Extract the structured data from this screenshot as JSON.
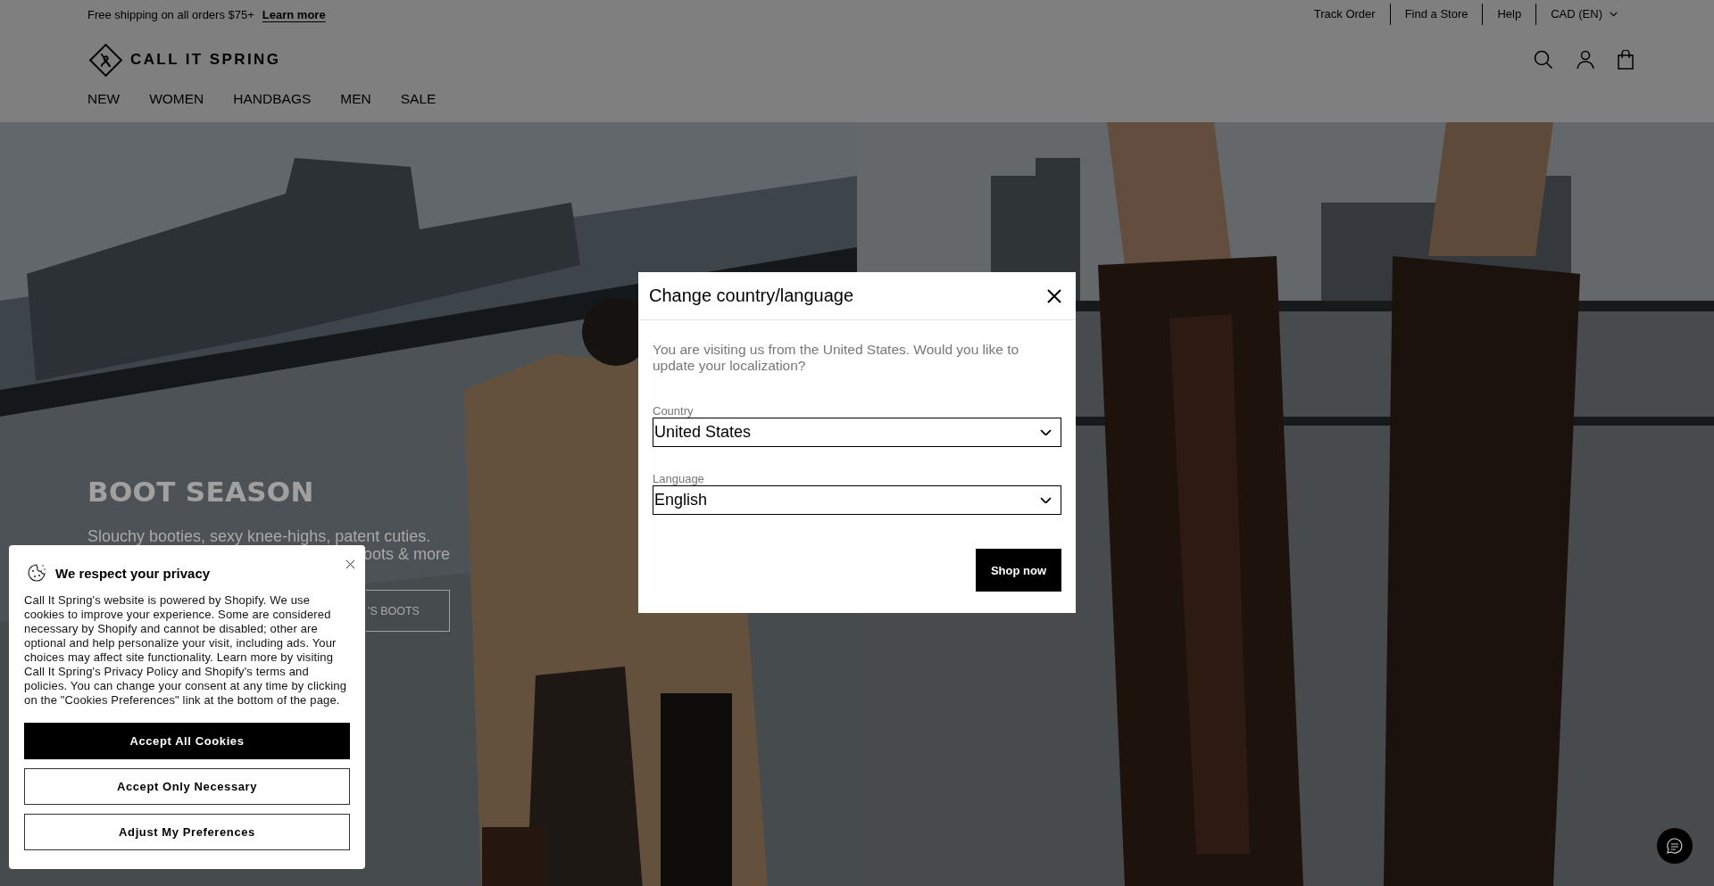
{
  "announcement": {
    "text": "Free shipping on all orders $75+",
    "link": "Learn more"
  },
  "utility_links": [
    {
      "label": "Track Order",
      "kind": "link"
    },
    {
      "label": "Find a Store",
      "kind": "link"
    },
    {
      "label": "Help",
      "kind": "link"
    },
    {
      "label": "CAD (EN)",
      "kind": "dropdown"
    }
  ],
  "logo": {
    "text": "CALL IT SPRING"
  },
  "nav": [
    "NEW",
    "WOMEN",
    "HANDBAGS",
    "MEN",
    "SALE"
  ],
  "hero": {
    "title": "BOOT SEASON",
    "subtitle_lines": [
      "Slouchy booties, sexy knee-highs, patent cuties.",
      "oots & more"
    ],
    "button": "'S BOOTS"
  },
  "modal": {
    "title": "Change country/language",
    "message": "You are visiting us from the United States. Would you like to update your localization?",
    "fields": [
      {
        "label": "Country",
        "value": "United States"
      },
      {
        "label": "Language",
        "value": "English"
      }
    ],
    "button": "Shop now"
  },
  "cookie_banner": {
    "title": "We respect your privacy",
    "body": "Call It Spring's website is powered by Shopify. We use cookies to improve your experience. Some are considered necessary by Shopify and cannot be disabled; other are optional and help personalize your visit, including ads. Your choices may affect site functionality. Learn more by visiting Call It Spring's Privacy Policy and Shopify's terms and policies. You can change your consent at any time by clicking on the \"Cookies Preferences\" link at the bottom of the page.",
    "buttons": [
      {
        "label": "Accept All Cookies",
        "kind": "primary"
      },
      {
        "label": "Accept Only Necessary",
        "kind": "secondary"
      },
      {
        "label": "Adjust My Preferences",
        "kind": "secondary"
      }
    ]
  }
}
